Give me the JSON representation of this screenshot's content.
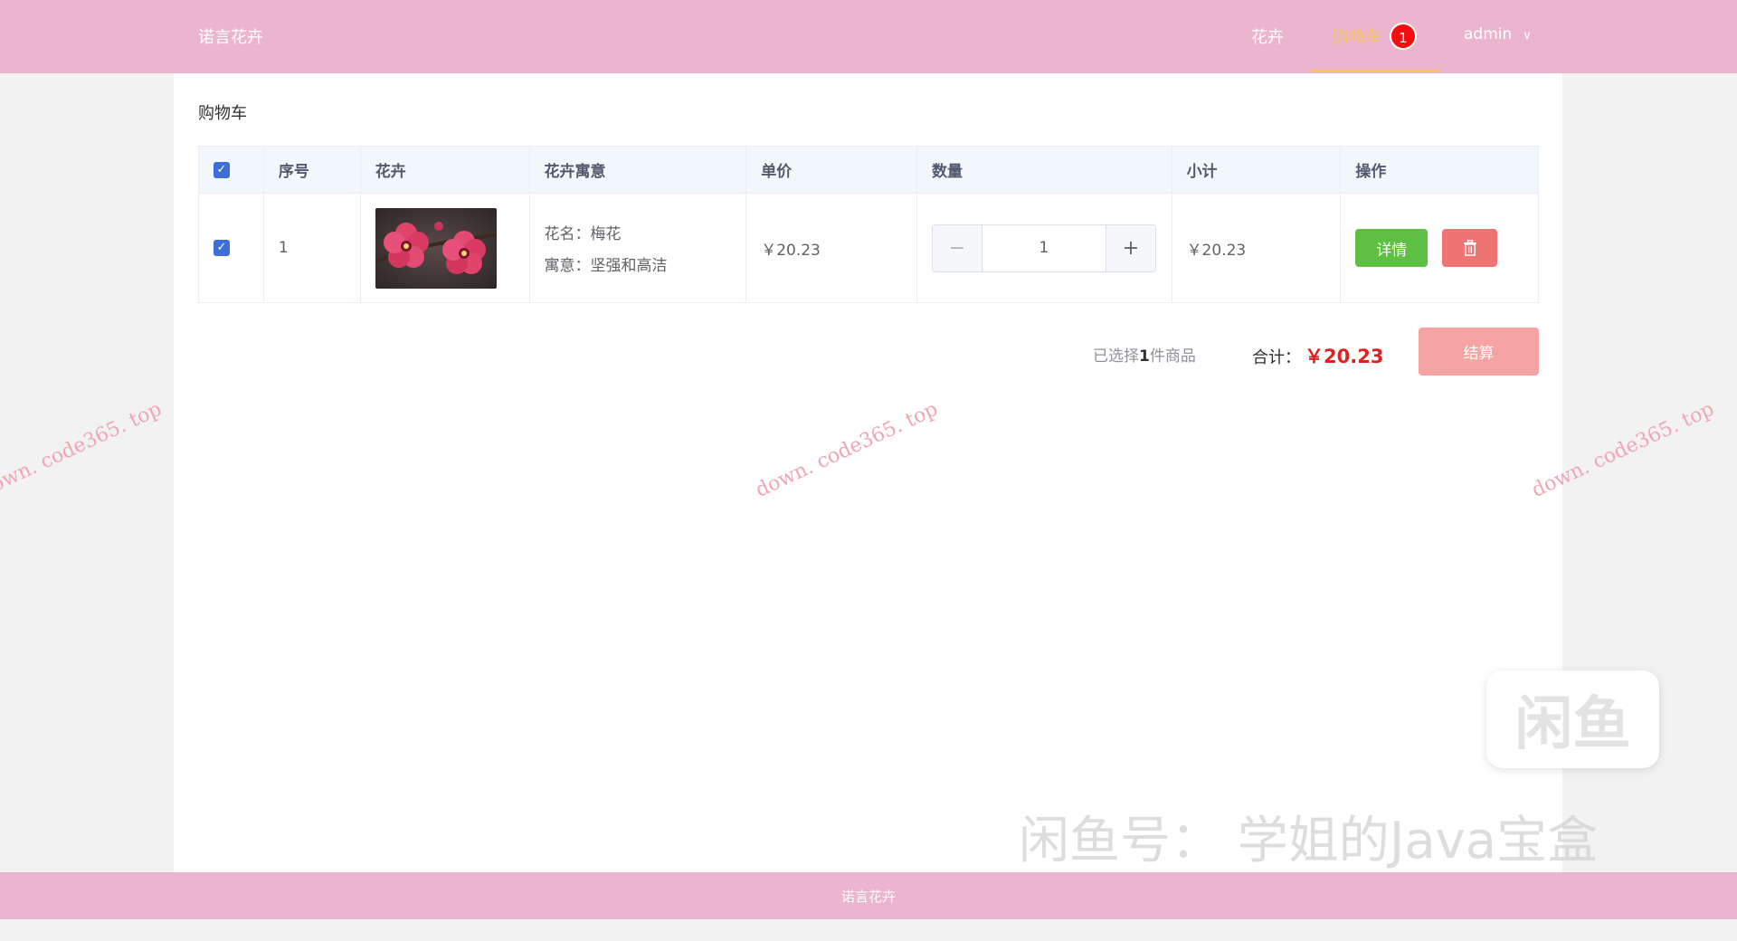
{
  "header": {
    "brand": "诺言花卉",
    "nav": {
      "flowers": "花卉",
      "cart": "购物车",
      "cart_badge": "1"
    },
    "user": {
      "name": "admin"
    }
  },
  "page": {
    "title": "购物车"
  },
  "cart_table": {
    "columns": [
      "序号",
      "花卉",
      "花卉寓意",
      "单价",
      "数量",
      "小计",
      "操作"
    ],
    "rows": [
      {
        "index": "1",
        "flower_name_line": "花名：梅花",
        "flower_meaning_line": "寓意：坚强和高洁",
        "unit_price": "￥20.23",
        "quantity": "1",
        "subtotal": "￥20.23",
        "detail_label": "详情"
      }
    ]
  },
  "summary": {
    "selected_prefix": "已选择",
    "selected_count": "1",
    "selected_suffix": "件商品",
    "total_label": "合计：",
    "total_value": "￥20.23",
    "checkout_label": "结算"
  },
  "watermarks": {
    "site": "down. code365. top"
  },
  "overlay": {
    "logo_text": "闲鱼",
    "account_text": "闲鱼号：  学姐的Java宝盒"
  },
  "footer": {
    "text": "诺言花卉"
  },
  "icons": {
    "checkbox": "check-icon",
    "trash": "trash-icon",
    "minus": "minus-icon",
    "plus": "plus-icon",
    "chevron": "chevron-down-icon"
  },
  "colors": {
    "header_bg": "#eab5cd",
    "active_nav": "#f5c46a",
    "badge": "#f30f0f",
    "detail_btn": "#5ec043",
    "delete_btn": "#f07474",
    "checkout_btn": "#f5a3a3",
    "total_price": "#e02020"
  }
}
